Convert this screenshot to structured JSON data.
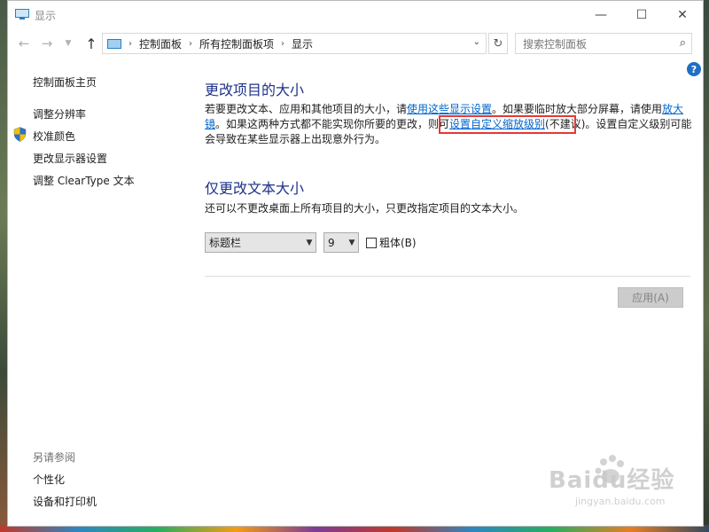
{
  "window": {
    "title": "显示"
  },
  "nav": {
    "crumbs": [
      "控制面板",
      "所有控制面板项",
      "显示"
    ],
    "search_placeholder": "搜索控制面板"
  },
  "sidebar": {
    "home": "控制面板主页",
    "items": [
      "调整分辨率",
      "校准颜色",
      "更改显示器设置",
      "调整 ClearType 文本"
    ],
    "see_also_title": "另请参阅",
    "see_also": [
      "个性化",
      "设备和打印机"
    ]
  },
  "main": {
    "heading1": "更改项目的大小",
    "para_1": "若要更改文本、应用和其他项目的大小，请",
    "link_1": "使用这些显示设置",
    "para_2": "。如果要临时放大部分屏幕，请使用",
    "link_2": "放大镜",
    "para_3": "。如果这两种方式都不能实现你所要的更改，则可",
    "link_3": "设置自定义缩放级别",
    "para_4": "(不建议)。设置自定义级别可能会导致在某些显示器上出现意外行为。",
    "heading2": "仅更改文本大小",
    "sub": "还可以不更改桌面上所有项目的大小，只更改指定项目的文本大小。",
    "item_select": "标题栏",
    "size_select": "9",
    "bold_label": "粗体(B)",
    "apply_label": "应用(A)"
  },
  "watermark": {
    "brand": "Baidu经验",
    "url": "jingyan.baidu.com"
  }
}
